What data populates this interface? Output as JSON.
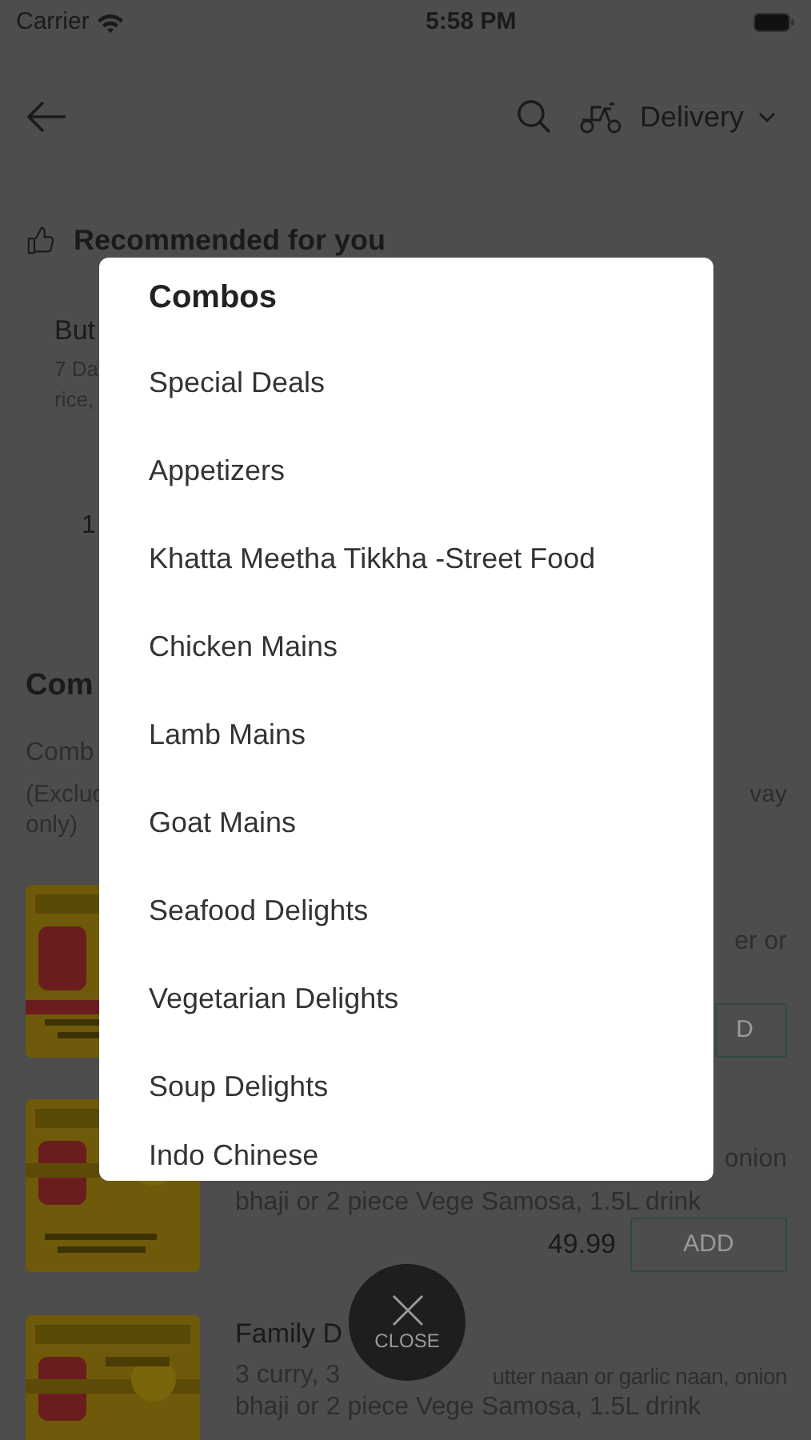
{
  "status_bar": {
    "carrier": "Carrier",
    "time": "5:58 PM"
  },
  "header": {
    "delivery_mode": "Delivery"
  },
  "recommended": {
    "title": "Recommended for you",
    "card": {
      "name": "But",
      "description_lines": [
        "7 Da",
        "rice,"
      ],
      "price": "1"
    }
  },
  "section": {
    "title": "Com",
    "subtitle": "Comb",
    "note_left": "(Excluc",
    "note_right": "vay",
    "note_line2": "only)"
  },
  "items": [
    {
      "picture": {
        "kind": "picture"
      },
      "lines": [
        {
          "right": "er or"
        }
      ],
      "add_label": "D"
    },
    {
      "picture": {
        "kind": "picture"
      },
      "lines": [
        {
          "right": "onion"
        },
        {
          "left": "bhaji or 2 piece Vege Samosa, 1.5L drink"
        }
      ],
      "price": "49.99",
      "add_label": "ADD"
    },
    {
      "picture": {
        "kind": "picture"
      },
      "name": "Family D",
      "lines": [
        {
          "left": "3 curry, 3",
          "right": "utter naan or garlic naan, onion"
        },
        {
          "left": "bhaji or 2 piece Vege Samosa, 1.5L drink"
        }
      ]
    }
  ],
  "menu": {
    "title": "Combos",
    "items": [
      "Special Deals",
      "Appetizers",
      "Khatta Meetha Tikkha -Street Food",
      "Chicken Mains",
      "Lamb Mains",
      "Goat Mains",
      "Seafood Delights",
      "Vegetarian Delights",
      "Soup Delights",
      "Indo Chinese"
    ],
    "close_label": "CLOSE"
  }
}
